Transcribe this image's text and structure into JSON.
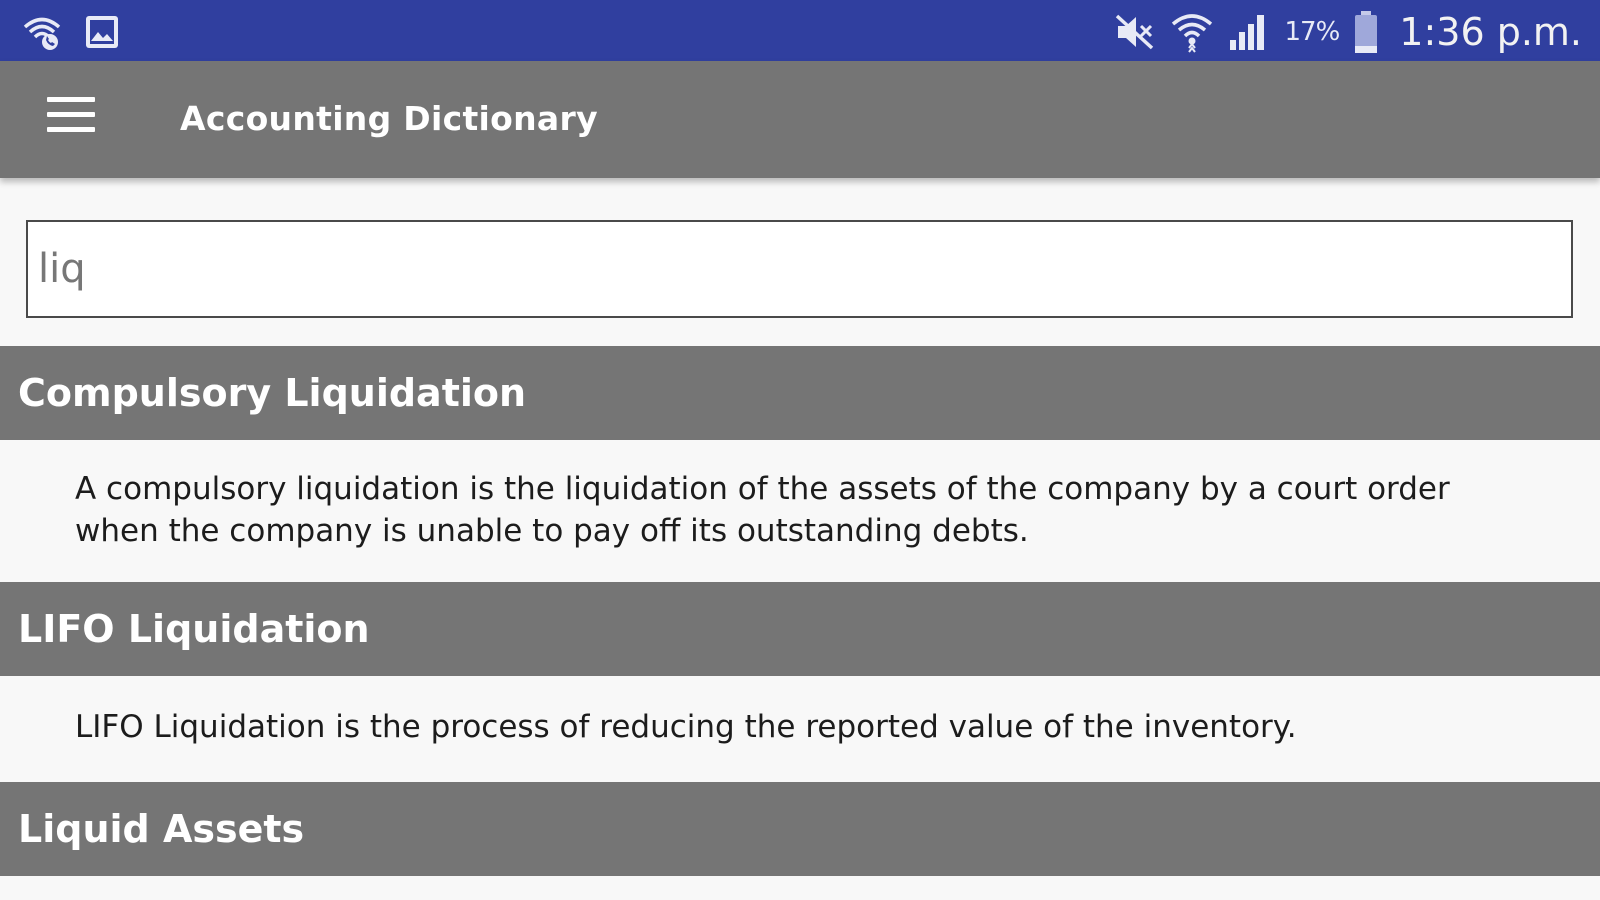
{
  "status_bar": {
    "battery_percent": "17%",
    "time": "1:36 p.m.",
    "icons": [
      "wifi-calling-icon",
      "image-notification-icon",
      "mute-icon",
      "wifi-icon",
      "signal-icon",
      "battery-icon"
    ]
  },
  "app_bar": {
    "title": "Accounting Dictionary",
    "menu_icon": "hamburger-menu-icon"
  },
  "search": {
    "value": "liq",
    "placeholder": ""
  },
  "results": [
    {
      "term": "Compulsory Liquidation",
      "definition": "A compulsory liquidation is the liquidation of the assets of the company by a court order when the company is unable to pay off its outstanding debts."
    },
    {
      "term": "LIFO Liquidation",
      "definition": "LIFO Liquidation is the process of reducing the reported value of the inventory."
    },
    {
      "term": "Liquid Assets",
      "definition": ""
    }
  ],
  "colors": {
    "status_bar": "#303f9f",
    "app_bar": "#757575",
    "term_header": "#757575",
    "background": "#f8f8f8"
  }
}
